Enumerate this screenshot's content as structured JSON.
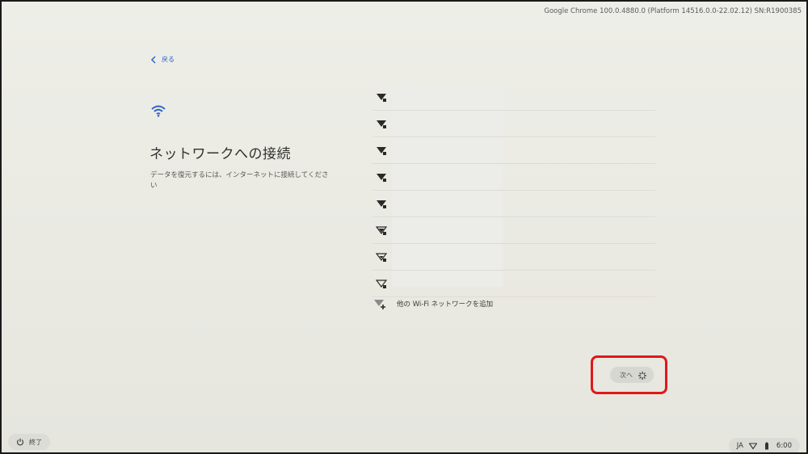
{
  "system": {
    "version_text": "Google Chrome 100.0.4880.0 (Platform 14516.0.0-22.02.12) SN:R1900385"
  },
  "nav": {
    "back_label": "戻る"
  },
  "main": {
    "title": "ネットワークへの接続",
    "subtitle": "データを復元するには、インターネットに接続してください"
  },
  "networks": {
    "count_visible": 8,
    "add_network_label": "他の Wi-Fi ネットワークを追加"
  },
  "footer": {
    "next_label": "次へ",
    "shutdown_label": "終了",
    "tray": {
      "language": "JA",
      "time": "6:00"
    }
  },
  "colors": {
    "accent": "#2f63c9",
    "highlight": "#e01818"
  }
}
